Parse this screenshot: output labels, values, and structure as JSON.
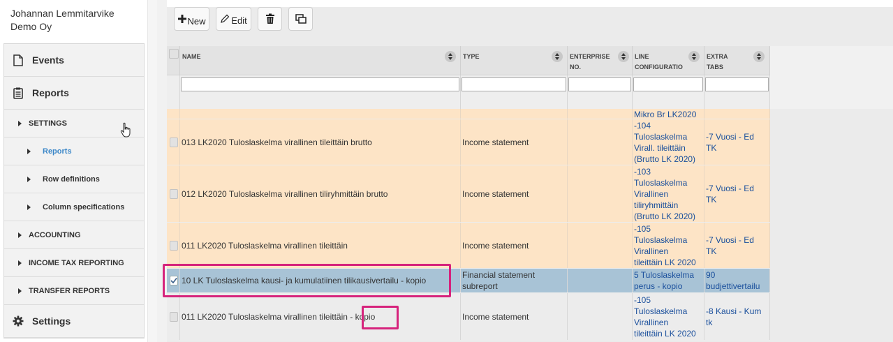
{
  "company": {
    "line1": "Johannan Lemmitarvike",
    "line2": "Demo Oy"
  },
  "sidebar": {
    "events": {
      "label": "Events",
      "icon": "document-icon"
    },
    "reports": {
      "label": "Reports",
      "icon": "report-icon"
    },
    "settings_section": "SETTINGS",
    "sub_reports": "Reports",
    "sub_row_definitions": "Row definitions",
    "sub_column_specifications": "Column specifications",
    "accounting": "ACCOUNTING",
    "income_tax": "INCOME TAX REPORTING",
    "transfer": "TRANSFER REPORTS",
    "settings": {
      "label": "Settings",
      "icon": "gear-icon"
    }
  },
  "toolbar": {
    "new_label": "New",
    "edit_label": "Edit"
  },
  "grid": {
    "headers": {
      "name": "NAME",
      "type": "TYPE",
      "enterprise_1": "ENTERPRISE",
      "enterprise_2": "NO.",
      "line_1": "LINE",
      "line_2": "CONFIGURATIO",
      "extra_1": "EXTRA",
      "extra_2": "TABS"
    },
    "rows": [
      {
        "name": "",
        "type": "",
        "enterprise": "",
        "line": "Mikro Br LK2020",
        "extra": ""
      },
      {
        "name": "013 LK2020 Tuloslaskelma virallinen tileittäin brutto",
        "type": "Income statement",
        "enterprise": "",
        "line": "-104\nTuloslaskelma\nVirall. tileittäin\n(Brutto LK 2020)",
        "extra": "-7 Vuosi - Ed\nTK"
      },
      {
        "name": "012 LK2020 Tuloslaskelma virallinen tiliryhmittäin brutto",
        "type": "Income statement",
        "enterprise": "",
        "line": "-103\nTuloslaskelma\nVirallinen\ntiliryhmittäin\n(Brutto LK 2020)",
        "extra": "-7 Vuosi - Ed\nTK"
      },
      {
        "name": "011 LK2020 Tuloslaskelma virallinen tileittäin",
        "type": "Income statement",
        "enterprise": "",
        "line": "-105\nTuloslaskelma\nVirallinen\ntileittäin LK 2020",
        "extra": "-7 Vuosi - Ed\nTK"
      },
      {
        "name": "10 LK Tuloslaskelma kausi- ja kumulatiinen tilikausivertailu - kopio",
        "type": "Financial statement\nsubreport",
        "enterprise": "",
        "line": "5 Tuloslaskelma\nperus - kopio",
        "extra": "90\nbudjettivertailu"
      },
      {
        "name": "011 LK2020 Tuloslaskelma virallinen tileittäin - kopio",
        "type": "Income statement",
        "enterprise": "",
        "line": "-105\nTuloslaskelma\nVirallinen\ntileittäin LK 2020",
        "extra": "-8 Kausi - Kum\ntk"
      }
    ]
  },
  "colors": {
    "highlight": "#d6237c",
    "row_orange": "#fde4c6",
    "row_selected": "#a8c3d6",
    "link": "#1a4f9c",
    "active_sub": "#3b87c8"
  }
}
